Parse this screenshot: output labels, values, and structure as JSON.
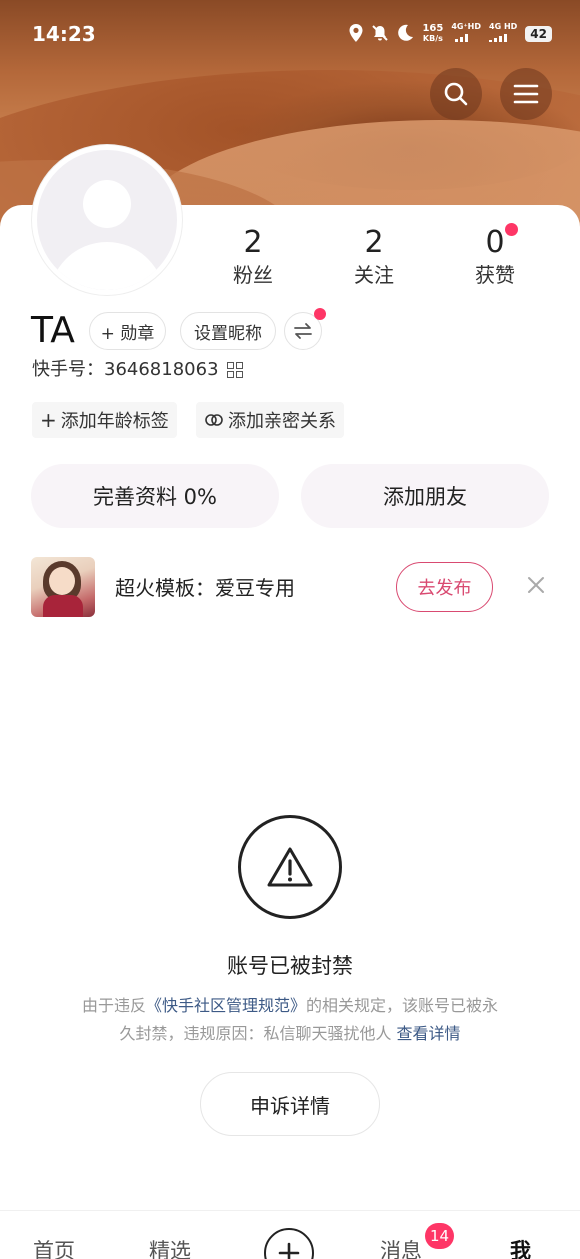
{
  "status_bar": {
    "time": "14:23",
    "net_speed_value": "165",
    "net_speed_unit": "KB/s",
    "signal1_label": "4G⁺HD",
    "signal2_label": "4G HD",
    "battery": "42"
  },
  "header": {
    "search_icon": "search-icon",
    "menu_icon": "hamburger-menu-icon"
  },
  "profile": {
    "nickname": "TA",
    "stats": {
      "fans_value": "2",
      "fans_label": "粉丝",
      "following_value": "2",
      "following_label": "关注",
      "likes_value": "0",
      "likes_label": "获赞"
    },
    "badge_chip": "+ 勋章",
    "set_nickname_chip": "设置昵称",
    "kuaishou_id": "快手号：3646818063",
    "tags": {
      "age": "添加年龄标签",
      "close_relation": "添加亲密关系"
    },
    "complete_profile": "完善资料 0%",
    "add_friend": "添加朋友"
  },
  "promo": {
    "text": "超火模板：爱豆专用",
    "publish_button": "去发布"
  },
  "banned": {
    "title": "账号已被封禁",
    "desc_part1": "由于违反",
    "desc_link": "《快手社区管理规范》",
    "desc_part2": "的相关规定，该账号已被永久封禁，违规原因：私信聊天骚扰他人",
    "desc_detail_link": "查看详情",
    "appeal_button": "申诉详情"
  },
  "tabbar": {
    "home": "首页",
    "featured": "精选",
    "messages": "消息",
    "messages_badge": "14",
    "me": "我"
  },
  "colors": {
    "accent_red": "#fe3666",
    "publish_pink": "#d94a71",
    "link_blue": "#3d5a86"
  }
}
